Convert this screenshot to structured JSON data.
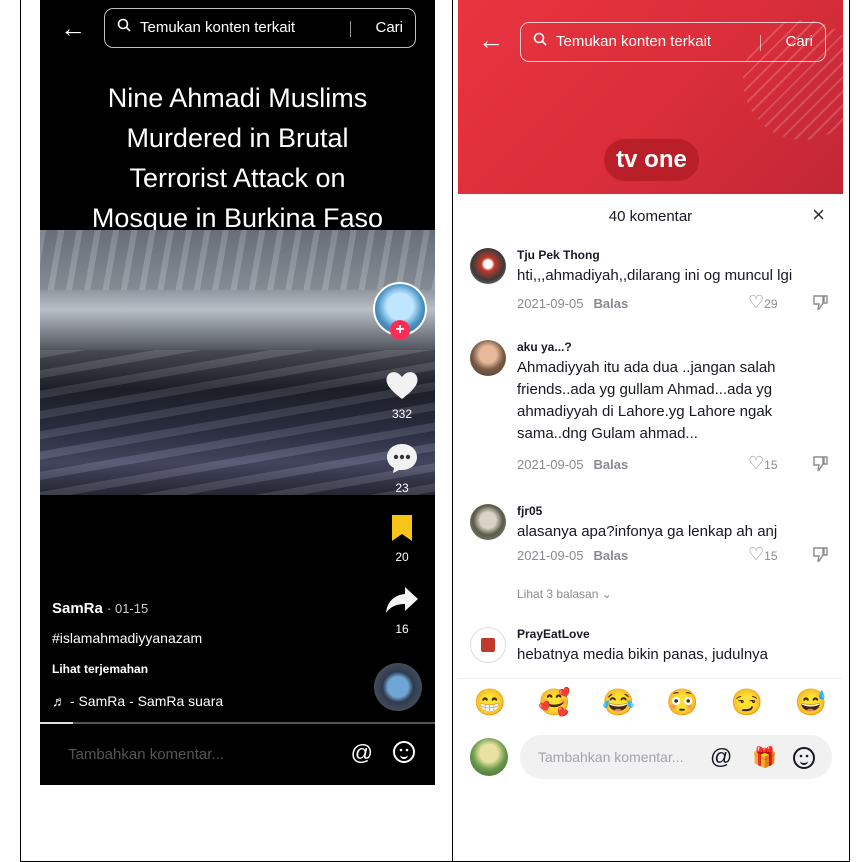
{
  "left": {
    "search": {
      "back_icon": "arrow-left-icon",
      "placeholder": "Temukan konten terkait",
      "button": "Cari"
    },
    "headline": [
      "Nine Ahmadi Muslims",
      "Murdered in Brutal",
      "Terrorist Attack on",
      "Mosque in Burkina Faso"
    ],
    "rail": {
      "likes": "332",
      "comments": "23",
      "saves": "20",
      "shares": "16"
    },
    "author": "SamRa",
    "date": "· 01-15",
    "hashtag": "#islamahmadiyyanazam",
    "translate": "Lihat terjemahan",
    "sound": "♬  - SamRa - SamRa   suara",
    "comment_placeholder": "Tambahkan komentar...",
    "at_symbol": "@"
  },
  "right": {
    "search": {
      "placeholder": "Temukan konten terkait",
      "button": "Cari"
    },
    "logo": "tv one",
    "sheet_title": "40 komentar",
    "close": "×",
    "reply_label": "Balas",
    "comments": [
      {
        "user": "Tju Pek Thong",
        "text": "hti,,,ahmadiyah,,dilarang ini og muncul lgi",
        "date": "2021-09-05",
        "likes": "29"
      },
      {
        "user": "aku ya...?",
        "text": "Ahmadiyyah itu ada dua ..jangan salah friends..ada yg gullam Ahmad...ada yg ahmadiyyah di Lahore.yg Lahore ngak sama..dng Gulam ahmad...",
        "date": "2021-09-05",
        "likes": "15"
      },
      {
        "user": "fjr05",
        "text": "alasanya apa?infonya ga lenkap ah anj",
        "date": "2021-09-05",
        "likes": "15"
      },
      {
        "user": "PrayEatLove",
        "text": "hebatnya media bikin panas, judulnya"
      }
    ],
    "more_replies": "Lihat 3 balasan ⌄",
    "emojis": [
      "😁",
      "🥰",
      "😂",
      "😳",
      "😏",
      "😅"
    ],
    "comment_placeholder": "Tambahkan komentar...",
    "at_symbol": "@",
    "gift_symbol": "🎁"
  }
}
